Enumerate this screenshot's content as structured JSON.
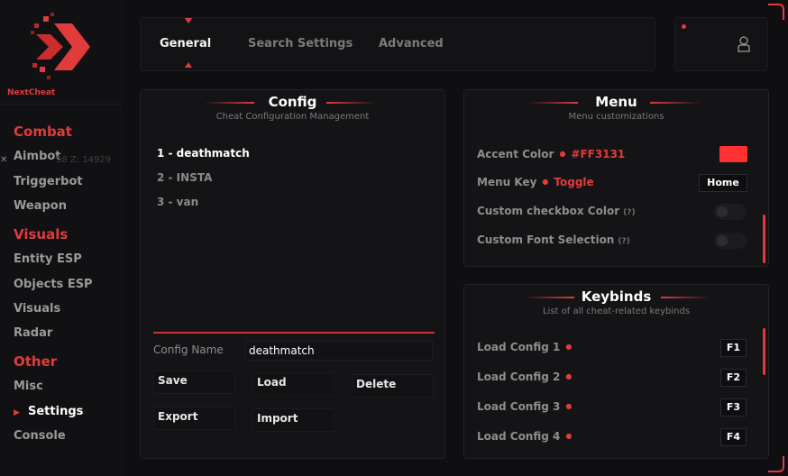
{
  "brand": {
    "name": "NextCheat"
  },
  "sidebar": {
    "sections": [
      {
        "title": "Combat",
        "items": [
          "Aimbot",
          "Triggerbot",
          "Weapon"
        ]
      },
      {
        "title": "Visuals",
        "items": [
          "Entity ESP",
          "Objects ESP",
          "Visuals",
          "Radar"
        ]
      },
      {
        "title": "Other",
        "items": [
          "Misc",
          "Settings",
          "Console"
        ]
      }
    ],
    "active_item": "Settings",
    "overlay_text": "58 Z: 14929"
  },
  "tabs": [
    "General",
    "Search Settings",
    "Advanced"
  ],
  "active_tab": "General",
  "config": {
    "title": "Config",
    "subtitle": "Cheat Configuration Management",
    "items": [
      "1 - deathmatch",
      "2 - INSTA",
      "3 - van"
    ],
    "selected": "1 - deathmatch",
    "name_label": "Config Name",
    "name_value": "deathmatch",
    "buttons": {
      "save": "Save",
      "load": "Load",
      "delete": "Delete",
      "export": "Export",
      "import": "Import"
    }
  },
  "menu": {
    "title": "Menu",
    "subtitle": "Menu customizations",
    "accent_label": "Accent Color",
    "accent_value": "#FF3131",
    "menu_key_label": "Menu Key",
    "menu_key_mode": "Toggle",
    "menu_key_value": "Home",
    "custom_checkbox_label": "Custom checkbox Color",
    "custom_font_label": "Custom Font Selection",
    "help_mark": "(?)"
  },
  "keybinds": {
    "title": "Keybinds",
    "subtitle": "List of all cheat-related keybinds",
    "items": [
      {
        "label": "Load Config 1",
        "key": "F1"
      },
      {
        "label": "Load Config 2",
        "key": "F2"
      },
      {
        "label": "Load Config 3",
        "key": "F3"
      },
      {
        "label": "Load Config 4",
        "key": "F4"
      }
    ]
  },
  "colors": {
    "accent": "#e23b3b",
    "panel": "#141417",
    "background": "#0f0f11"
  }
}
